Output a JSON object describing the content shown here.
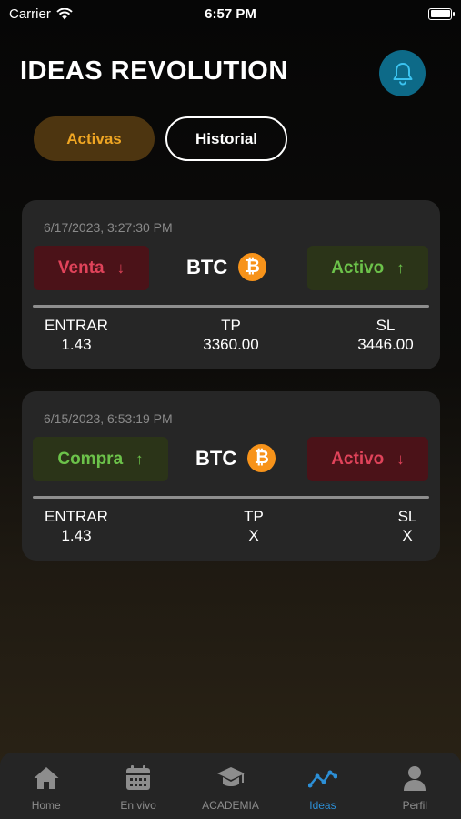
{
  "status_bar": {
    "carrier": "Carrier",
    "time": "6:57 PM"
  },
  "header": {
    "title": "IDEAS REVOLUTION",
    "bell_icon": "bell-icon"
  },
  "tabs": [
    {
      "label": "Activas",
      "active": true
    },
    {
      "label": "Historial",
      "active": false
    }
  ],
  "cards": [
    {
      "date": "6/17/2023, 3:27:30 PM",
      "direction": {
        "label": "Venta",
        "arrow": "↓",
        "color": "#e0435a"
      },
      "coin": {
        "symbol": "BTC",
        "icon": "bitcoin-icon",
        "glyph": "₿"
      },
      "status": {
        "label": "Activo",
        "arrow": "↑",
        "color": "#6cc24a"
      },
      "columns": {
        "entry_label": "ENTRAR",
        "entry": "1.43",
        "tp_label": "TP",
        "tp": "3360.00",
        "sl_label": "SL",
        "sl": "3446.00"
      }
    },
    {
      "date": "6/15/2023, 6:53:19 PM",
      "direction": {
        "label": "Compra",
        "arrow": "↑",
        "color": "#6cc24a"
      },
      "coin": {
        "symbol": "BTC",
        "icon": "bitcoin-icon",
        "glyph": "₿"
      },
      "status": {
        "label": "Activo",
        "arrow": "↓",
        "color": "#e0435a"
      },
      "columns": {
        "entry_label": "ENTRAR",
        "entry": "1.43",
        "tp_label": "TP",
        "tp": "X",
        "sl_label": "SL",
        "sl": "X"
      }
    }
  ],
  "tab_bar": [
    {
      "label": "Home",
      "icon": "home-icon",
      "active": false
    },
    {
      "label": "En vivo",
      "icon": "calendar-icon",
      "active": false
    },
    {
      "label": "ACADEMIA",
      "icon": "graduation-cap-icon",
      "active": false
    },
    {
      "label": "Ideas",
      "icon": "trend-chart-icon",
      "active": true
    },
    {
      "label": "Perfil",
      "icon": "user-icon",
      "active": false
    }
  ],
  "colors": {
    "accent_blue": "#2c8fd6",
    "gold": "#f0a623",
    "bitcoin": "#f7931a"
  }
}
